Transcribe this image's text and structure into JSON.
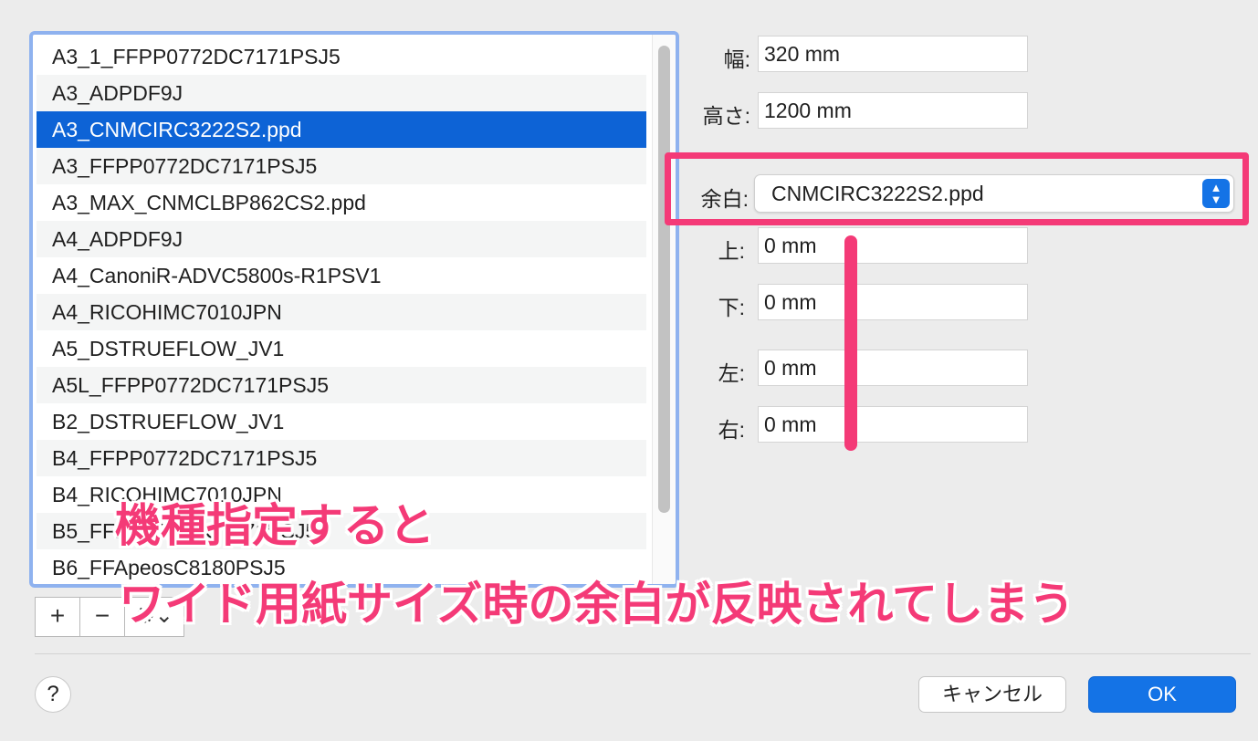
{
  "list": {
    "items": [
      "A3_1_FFPP0772DC7171PSJ5",
      "A3_ADPDF9J",
      "A3_CNMCIRC3222S2.ppd",
      "A3_FFPP0772DC7171PSJ5",
      "A3_MAX_CNMCLBP862CS2.ppd",
      "A4_ADPDF9J",
      "A4_CanoniR-ADVC5800s-R1PSV1",
      "A4_RICOHIMC7010JPN",
      "A5_DSTRUEFLOW_JV1",
      "A5L_FFPP0772DC7171PSJ5",
      "B2_DSTRUEFLOW_JV1",
      "B4_FFPP0772DC7171PSJ5",
      "B4_RICOHIMC7010JPN",
      "B5_FFPP0772DC7171PSJ5",
      "B6_FFApeosC8180PSJ5"
    ],
    "selected_index": 2,
    "add_label": "+",
    "remove_label": "−",
    "gear_label": "⚙⌄"
  },
  "form": {
    "width_label": "幅:",
    "width_value": "320 mm",
    "height_label": "高さ:",
    "height_value": "1200 mm",
    "margin_label": "余白:",
    "margin_value": "CNMCIRC3222S2.ppd",
    "top_label": "上:",
    "top_value": "0 mm",
    "bottom_label": "下:",
    "bottom_value": "0 mm",
    "left_label": "左:",
    "left_value": "0 mm",
    "right_label": "右:",
    "right_value": "0 mm"
  },
  "annotation": {
    "line1": "機種指定すると",
    "line2": "ワイド用紙サイズ時の余白が反映されてしまう",
    "color": "#f43a77"
  },
  "buttons": {
    "help": "?",
    "cancel": "キャンセル",
    "ok": "OK"
  },
  "colors": {
    "accent": "#1473e6",
    "selection": "#0d63d6"
  }
}
